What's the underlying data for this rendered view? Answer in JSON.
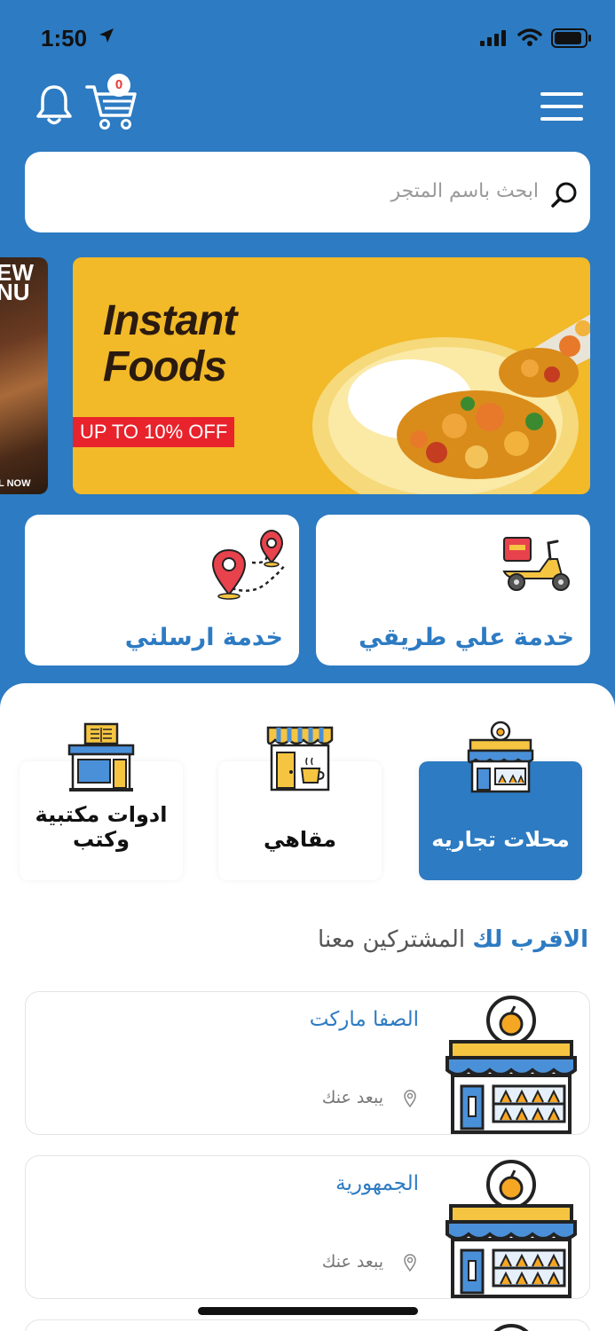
{
  "status": {
    "time": "1:50"
  },
  "header": {
    "cart_count": "0"
  },
  "search": {
    "placeholder": "ابحث باسم المتجر"
  },
  "banner": {
    "title_line1": "Instant",
    "title_line2": "Foods",
    "discount": "UP TO 10% OFF"
  },
  "banner_left": {
    "text": "EW\nNU",
    "footer": "L NOW"
  },
  "services": [
    {
      "label": "خدمة  علي طريقي",
      "icon": "scooter-icon"
    },
    {
      "label": "خدمة  ارسلني",
      "icon": "route-pin-icon"
    }
  ],
  "categories": [
    {
      "label": "محلات تجاريه",
      "icon": "shop-icon",
      "selected": true
    },
    {
      "label": "مقاهي",
      "icon": "cafe-icon",
      "selected": false
    },
    {
      "label": "ادوات مكتبية وكتب",
      "icon": "bookstore-icon",
      "selected": false
    }
  ],
  "nearest_section": {
    "title_bold": "الاقرب لك",
    "title_rest": "المشتركين معنا"
  },
  "stores": [
    {
      "name": "الصفا ماركت",
      "distance": "يبعد عنك"
    },
    {
      "name": "الجمهورية",
      "distance": "يبعد عنك"
    }
  ],
  "colors": {
    "primary": "#2d7bc2",
    "banner": "#f2b928",
    "badge": "#e53935"
  }
}
